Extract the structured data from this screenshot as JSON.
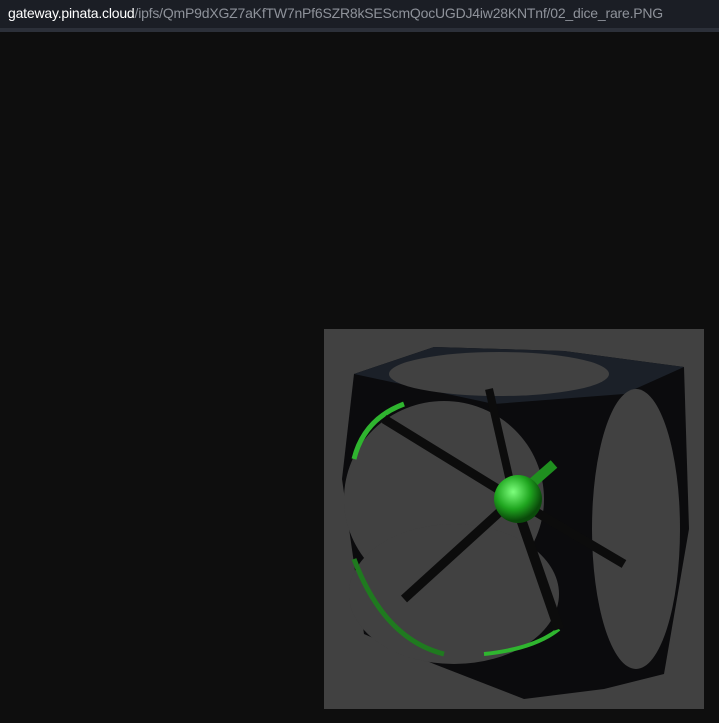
{
  "address_bar": {
    "host": "gateway.pinata.cloud",
    "path": "/ipfs/QmP9dXGZ7aKfTW7nPf6SZR8kSEScmQocUGDJ4iw28KNTnf/02_dice_rare.PNG"
  },
  "image": {
    "subject": "dice-render",
    "accent_color": "#2fd52f",
    "background_color": "#414141"
  }
}
